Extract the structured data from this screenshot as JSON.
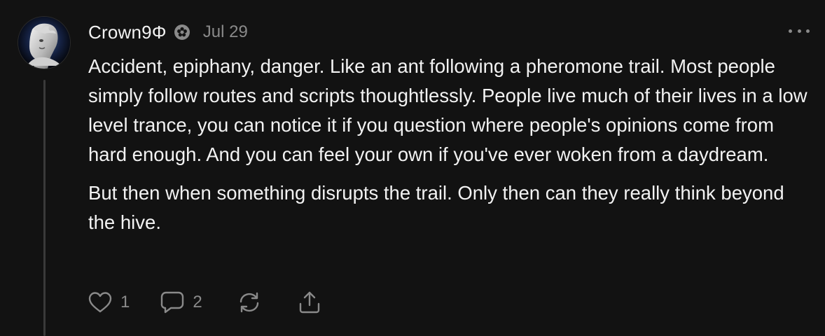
{
  "comment": {
    "author": "Crown9Φ",
    "date": "Jul 29",
    "badge_icon": "flower-badge-icon",
    "paragraphs": [
      "Accident, epiphany, danger. Like an ant following a pheromone trail. Most people simply follow routes and scripts thoughtlessly. People live much of their lives in a low level trance, you can notice it if you question where people's opinions come from hard enough. And you can feel your own if you've ever woken from a daydream.",
      "But then when something disrupts the trail. Only then can they really think beyond the hive."
    ],
    "actions": {
      "likes": "1",
      "replies": "2",
      "like_icon": "heart-icon",
      "reply_icon": "speech-bubble-icon",
      "restack_icon": "restack-icon",
      "share_icon": "share-icon"
    }
  },
  "colors": {
    "background": "#121212",
    "text": "#f2f2f2",
    "muted": "#8a8a8a",
    "thread_line": "#3a3a3a"
  }
}
